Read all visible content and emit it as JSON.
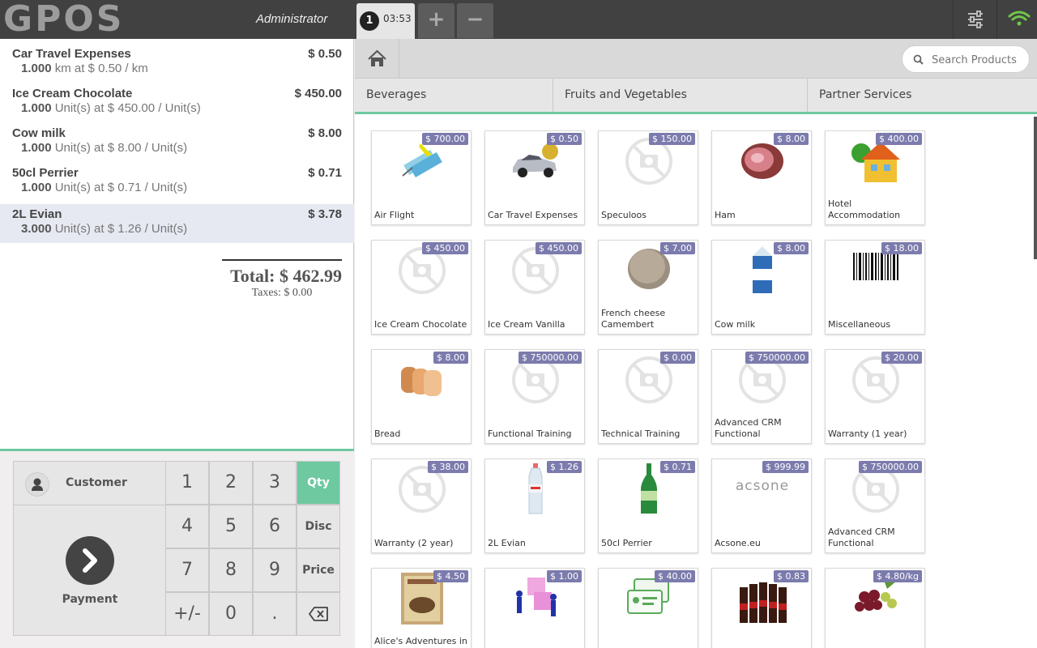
{
  "header": {
    "logo": "GPOS",
    "cashier": "Administrator",
    "order_tab": {
      "number": "1",
      "time": "03:53"
    },
    "add_label": "+",
    "remove_label": "−"
  },
  "order": {
    "lines": [
      {
        "name": "Car Travel Expenses",
        "price": "$ 0.50",
        "qty": "1.000",
        "detail": " km at $ 0.50 / km"
      },
      {
        "name": "Ice Cream Chocolate",
        "price": "$ 450.00",
        "qty": "1.000",
        "detail": " Unit(s) at $ 450.00 / Unit(s)"
      },
      {
        "name": "Cow milk",
        "price": "$ 8.00",
        "qty": "1.000",
        "detail": " Unit(s) at $ 8.00 / Unit(s)"
      },
      {
        "name": "50cl Perrier",
        "price": "$ 0.71",
        "qty": "1.000",
        "detail": " Unit(s) at $ 0.71 / Unit(s)"
      },
      {
        "name": "2L Evian",
        "price": "$ 3.78",
        "qty": "3.000",
        "detail": " Unit(s) at $ 1.26 / Unit(s)"
      }
    ],
    "total": "Total: $ 462.99",
    "taxes": "Taxes: $ 0.00"
  },
  "numpad": {
    "customer_label": "Customer",
    "payment_label": "Payment",
    "keys": [
      "1",
      "2",
      "3",
      "4",
      "5",
      "6",
      "7",
      "8",
      "9",
      "+/-",
      "0",
      "."
    ],
    "modes": [
      "Qty",
      "Disc",
      "Price"
    ],
    "active_mode": "Qty"
  },
  "search": {
    "placeholder": "Search Products"
  },
  "categories": [
    "Beverages",
    "Fruits and Vegetables",
    "Partner Services"
  ],
  "colors": {
    "accent": "#6ec8a0",
    "price_tag": "#7c7bad",
    "topbar": "#414141"
  },
  "products": [
    {
      "name": "Air Flight",
      "price": "$ 700.00",
      "icon": "airplane-tickets-icon"
    },
    {
      "name": "Car Travel Expenses",
      "price": "$ 0.50",
      "icon": "car-icon"
    },
    {
      "name": "Speculoos",
      "price": "$ 150.00",
      "icon": "no-image-icon"
    },
    {
      "name": "Ham",
      "price": "$ 8.00",
      "icon": "ham-icon"
    },
    {
      "name": "Hotel Accommodation",
      "price": "$ 400.00",
      "icon": "house-icon"
    },
    {
      "name": "Ice Cream Chocolate",
      "price": "$ 450.00",
      "icon": "no-image-icon"
    },
    {
      "name": "Ice Cream Vanilla",
      "price": "$ 450.00",
      "icon": "no-image-icon"
    },
    {
      "name": "French cheese Camembert",
      "price": "$ 7.00",
      "icon": "cheese-icon"
    },
    {
      "name": "Cow milk",
      "price": "$ 8.00",
      "icon": "milk-carton-icon"
    },
    {
      "name": "Miscellaneous",
      "price": "$ 18.00",
      "icon": "barcode-icon"
    },
    {
      "name": "Bread",
      "price": "$ 8.00",
      "icon": "bread-icon"
    },
    {
      "name": "Functional Training",
      "price": "$ 750000.00",
      "icon": "no-image-icon"
    },
    {
      "name": "Technical Training",
      "price": "$ 0.00",
      "icon": "no-image-icon"
    },
    {
      "name": "Advanced CRM Functional",
      "price": "$ 750000.00",
      "icon": "no-image-icon"
    },
    {
      "name": "Warranty (1 year)",
      "price": "$ 20.00",
      "icon": "no-image-icon"
    },
    {
      "name": "Warranty (2 year)",
      "price": "$ 38.00",
      "icon": "no-image-icon"
    },
    {
      "name": "2L Evian",
      "price": "$ 1.26",
      "icon": "water-bottle-icon"
    },
    {
      "name": "50cl Perrier",
      "price": "$ 0.71",
      "icon": "green-bottle-icon"
    },
    {
      "name": "Acsone.eu",
      "price": "$ 999.99",
      "icon": "acsone-logo-icon",
      "logo_text": "acsone"
    },
    {
      "name": "Advanced CRM Functional",
      "price": "$ 750000.00",
      "icon": "no-image-icon"
    },
    {
      "name": "Alice's Adventures in Wonderland - Lewis",
      "price": "$ 4.50",
      "icon": "book-cover-icon"
    },
    {
      "name": "",
      "price": "$ 1.00",
      "icon": "puzzle-people-icon"
    },
    {
      "name": "",
      "price": "$ 40.00",
      "icon": "id-cards-icon"
    },
    {
      "name": "",
      "price": "$ 0.83",
      "icon": "beer-bottles-icon"
    },
    {
      "name": "",
      "price": "$ 4.80/kg",
      "icon": "grapes-icon"
    }
  ]
}
